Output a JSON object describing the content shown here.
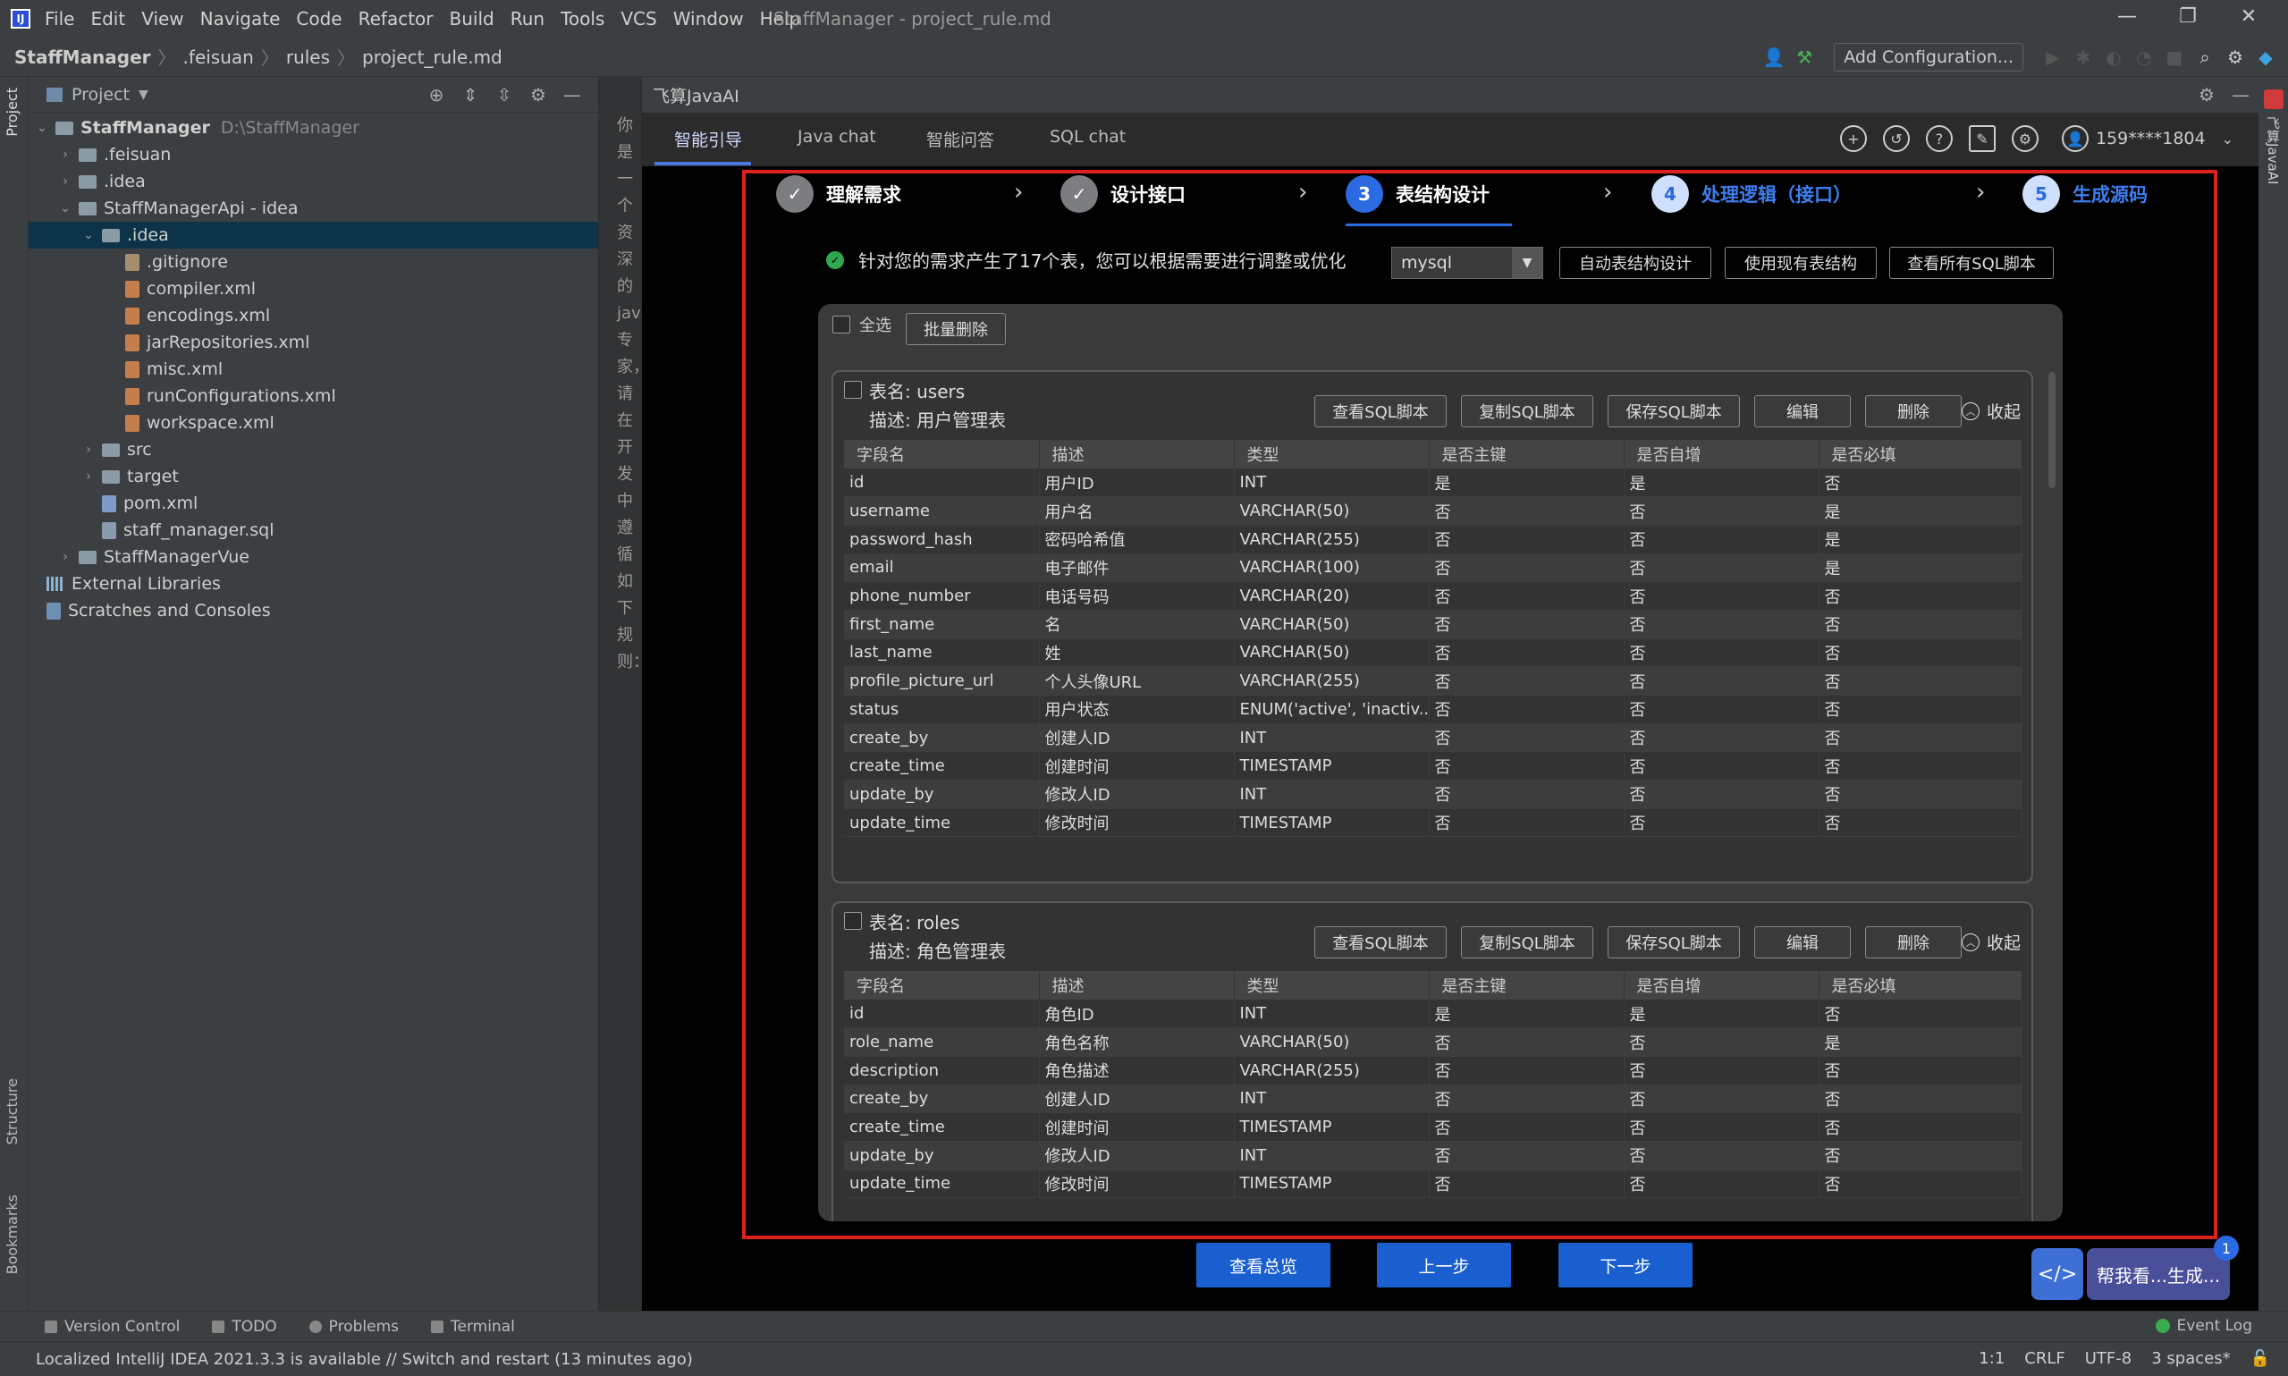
{
  "window": {
    "title": "StaffManager - project_rule.md"
  },
  "menu": [
    "File",
    "Edit",
    "View",
    "Navigate",
    "Code",
    "Refactor",
    "Build",
    "Run",
    "Tools",
    "VCS",
    "Window",
    "Help"
  ],
  "breadcrumb": [
    "StaffManager",
    ".feisuan",
    "rules",
    "project_rule.md"
  ],
  "toolbar": {
    "add_config": "Add Configuration..."
  },
  "side_tabs": {
    "project": "Project",
    "structure": "Structure",
    "bookmarks": "Bookmarks"
  },
  "project_panel": {
    "title": "Project",
    "root_name": "StaffManager",
    "root_path": "D:\\StaffManager",
    "items": {
      "feisuan": ".feisuan",
      "idea_root": ".idea",
      "api": "StaffManagerApi - idea",
      "idea_api": ".idea",
      "gitignore": ".gitignore",
      "compiler": "compiler.xml",
      "encodings": "encodings.xml",
      "jarrepos": "jarRepositories.xml",
      "misc": "misc.xml",
      "runconfigs": "runConfigurations.xml",
      "workspace": "workspace.xml",
      "src": "src",
      "target": "target",
      "pom": "pom.xml",
      "sql": "staff_manager.sql",
      "vue": "StaffManagerVue",
      "extlibs": "External Libraries",
      "scratches": "Scratches and Consoles"
    }
  },
  "editor_column_text": "你是一个资深的java专家，请在开发中遵循如下规则：",
  "tool": {
    "title": "飞算JavaAI",
    "tabs": [
      "智能引导",
      "Java chat",
      "智能问答",
      "SQL chat"
    ],
    "account": "159****1804",
    "steps": [
      {
        "num": "✓",
        "label": "理解需求"
      },
      {
        "num": "✓",
        "label": "设计接口"
      },
      {
        "num": "3",
        "label": "表结构设计"
      },
      {
        "num": "4",
        "label": "处理逻辑（接口）"
      },
      {
        "num": "5",
        "label": "生成源码"
      }
    ],
    "info": "针对您的需求产生了17个表，您可以根据需要进行调整或优化",
    "db": "mysql",
    "buttons": {
      "auto": "自动表结构设计",
      "existing": "使用现有表结构",
      "viewall": "查看所有SQL脚本"
    },
    "select_all": "全选",
    "batch_delete": "批量删除",
    "card_actions": [
      "查看SQL脚本",
      "复制SQL脚本",
      "保存SQL脚本",
      "编辑",
      "删除"
    ],
    "collapse": "收起",
    "columns": [
      "字段名",
      "描述",
      "类型",
      "是否主键",
      "是否自增",
      "是否必填"
    ],
    "tables": [
      {
        "name": "表名: users",
        "desc": "描述: 用户管理表",
        "rows": [
          [
            "id",
            "用户ID",
            "INT",
            "是",
            "是",
            "否"
          ],
          [
            "username",
            "用户名",
            "VARCHAR(50)",
            "否",
            "否",
            "是"
          ],
          [
            "password_hash",
            "密码哈希值",
            "VARCHAR(255)",
            "否",
            "否",
            "是"
          ],
          [
            "email",
            "电子邮件",
            "VARCHAR(100)",
            "否",
            "否",
            "是"
          ],
          [
            "phone_number",
            "电话号码",
            "VARCHAR(20)",
            "否",
            "否",
            "否"
          ],
          [
            "first_name",
            "名",
            "VARCHAR(50)",
            "否",
            "否",
            "否"
          ],
          [
            "last_name",
            "姓",
            "VARCHAR(50)",
            "否",
            "否",
            "否"
          ],
          [
            "profile_picture_url",
            "个人头像URL",
            "VARCHAR(255)",
            "否",
            "否",
            "否"
          ],
          [
            "status",
            "用户状态",
            "ENUM('active', 'inactiv...",
            "否",
            "否",
            "否"
          ],
          [
            "create_by",
            "创建人ID",
            "INT",
            "否",
            "否",
            "否"
          ],
          [
            "create_time",
            "创建时间",
            "TIMESTAMP",
            "否",
            "否",
            "否"
          ],
          [
            "update_by",
            "修改人ID",
            "INT",
            "否",
            "否",
            "否"
          ],
          [
            "update_time",
            "修改时间",
            "TIMESTAMP",
            "否",
            "否",
            "否"
          ]
        ]
      },
      {
        "name": "表名: roles",
        "desc": "描述: 角色管理表",
        "rows": [
          [
            "id",
            "角色ID",
            "INT",
            "是",
            "是",
            "否"
          ],
          [
            "role_name",
            "角色名称",
            "VARCHAR(50)",
            "否",
            "否",
            "是"
          ],
          [
            "description",
            "角色描述",
            "VARCHAR(255)",
            "否",
            "否",
            "否"
          ],
          [
            "create_by",
            "创建人ID",
            "INT",
            "否",
            "否",
            "否"
          ],
          [
            "create_time",
            "创建时间",
            "TIMESTAMP",
            "否",
            "否",
            "否"
          ],
          [
            "update_by",
            "修改人ID",
            "INT",
            "否",
            "否",
            "否"
          ],
          [
            "update_time",
            "修改时间",
            "TIMESTAMP",
            "否",
            "否",
            "否"
          ]
        ]
      }
    ],
    "nav": {
      "overview": "查看总览",
      "prev": "上一步",
      "next": "下一步"
    },
    "helper": {
      "text": "帮我看...生成...",
      "badge": "1"
    }
  },
  "right_stripe": "飞算JavaAI",
  "bottom_tabs": [
    "Version Control",
    "TODO",
    "Problems",
    "Terminal"
  ],
  "event_log": "Event Log",
  "status": {
    "message": "Localized IntelliJ IDEA 2021.3.3 is available // Switch and restart (13 minutes ago)",
    "pos": "1:1",
    "eol": "CRLF",
    "enc": "UTF-8",
    "indent": "3 spaces*"
  }
}
